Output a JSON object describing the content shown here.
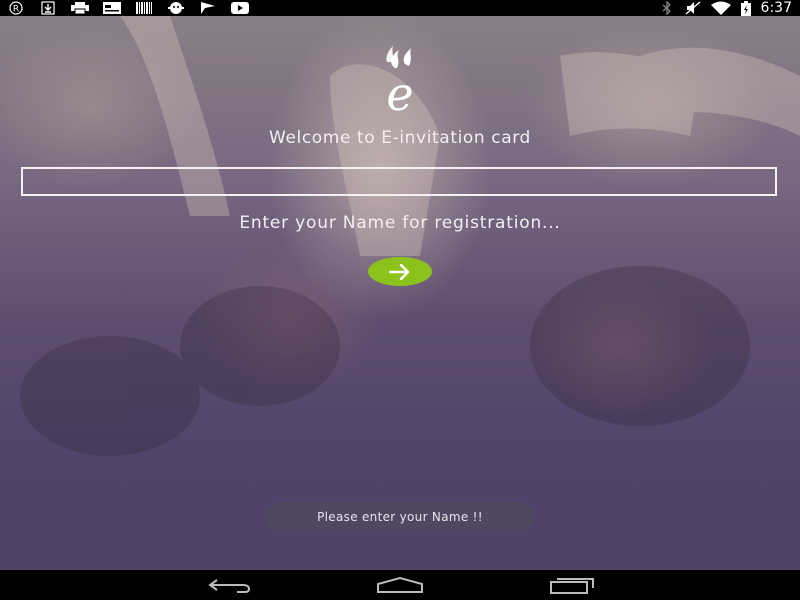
{
  "status_bar": {
    "time": "6:37",
    "left_icons": [
      "registered-icon",
      "download-icon",
      "printer-icon",
      "card-icon",
      "barcode-icon",
      "android-icon",
      "flag-icon",
      "youtube-icon"
    ],
    "right_icons": [
      "bluetooth-icon",
      "mute-icon",
      "wifi-icon",
      "battery-icon"
    ]
  },
  "app": {
    "logo_letter": "e",
    "welcome_text": "Welcome to E-invitation card",
    "name_input": {
      "value": "",
      "placeholder": ""
    },
    "hint_text": "Enter your Name for registration...",
    "submit_icon": "arrow-right-icon",
    "toast_text": "Please enter your Name !!"
  },
  "colors": {
    "accent_button": "#8cc21a",
    "overlay": "#52436a"
  },
  "nav_bar": {
    "buttons": [
      "back-icon",
      "home-icon",
      "recents-icon"
    ]
  }
}
